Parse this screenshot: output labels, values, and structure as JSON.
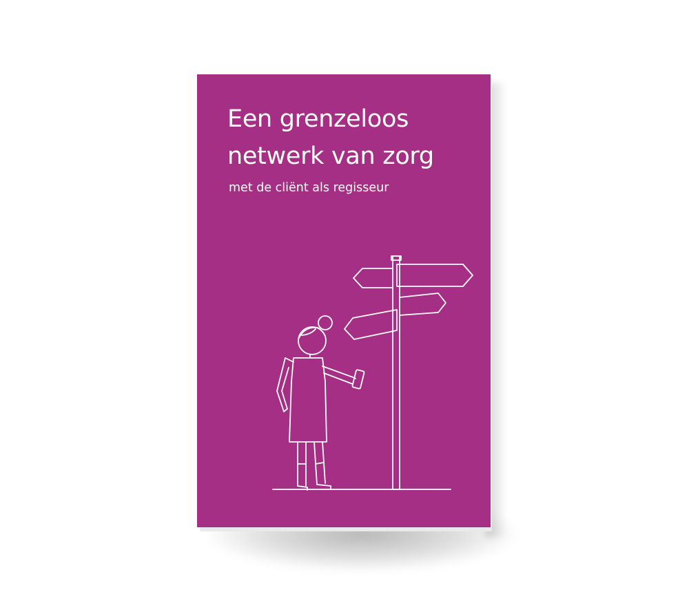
{
  "book": {
    "title_lines": [
      "Een grenzeloos",
      "netwerk van zorg"
    ],
    "subtitle": "met de cliënt als regisseur",
    "cover_color": "#a42f85",
    "line_color": "#ffffff",
    "illustration": "woman-at-signpost-icon"
  }
}
